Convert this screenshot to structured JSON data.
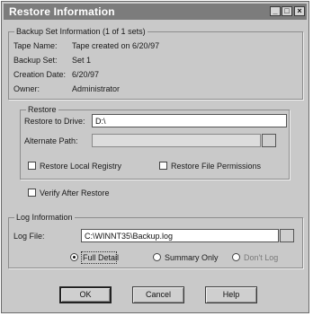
{
  "window": {
    "title": "Restore Information",
    "minimize_glyph": "_",
    "maximize_glyph": "□",
    "close_glyph": "×"
  },
  "backup_set": {
    "group_label": "Backup Set Information (1 of 1 sets)",
    "tape_name_label": "Tape Name:",
    "tape_name_value": "Tape created on 6/20/97",
    "backup_set_label": "Backup Set:",
    "backup_set_value": "Set 1",
    "creation_date_label": "Creation Date:",
    "creation_date_value": "6/20/97",
    "owner_label": "Owner:",
    "owner_value": "Administrator"
  },
  "restore": {
    "group_label": "Restore",
    "drive_label": "Restore to Drive:",
    "drive_value": "D:\\",
    "alternate_path_label": "Alternate Path:",
    "alternate_path_value": "",
    "restore_registry_label": "Restore Local Registry",
    "restore_permissions_label": "Restore File Permissions",
    "verify_label": "Verify After Restore"
  },
  "log": {
    "group_label": "Log Information",
    "log_file_label": "Log File:",
    "log_file_value": "C:\\WINNT35\\Backup.log",
    "full_detail_label": "Full Detail",
    "summary_only_label": "Summary Only",
    "dont_log_label": "Don't Log",
    "selected_option": "Full Detail"
  },
  "buttons": {
    "ok": "OK",
    "cancel": "Cancel",
    "help": "Help"
  }
}
